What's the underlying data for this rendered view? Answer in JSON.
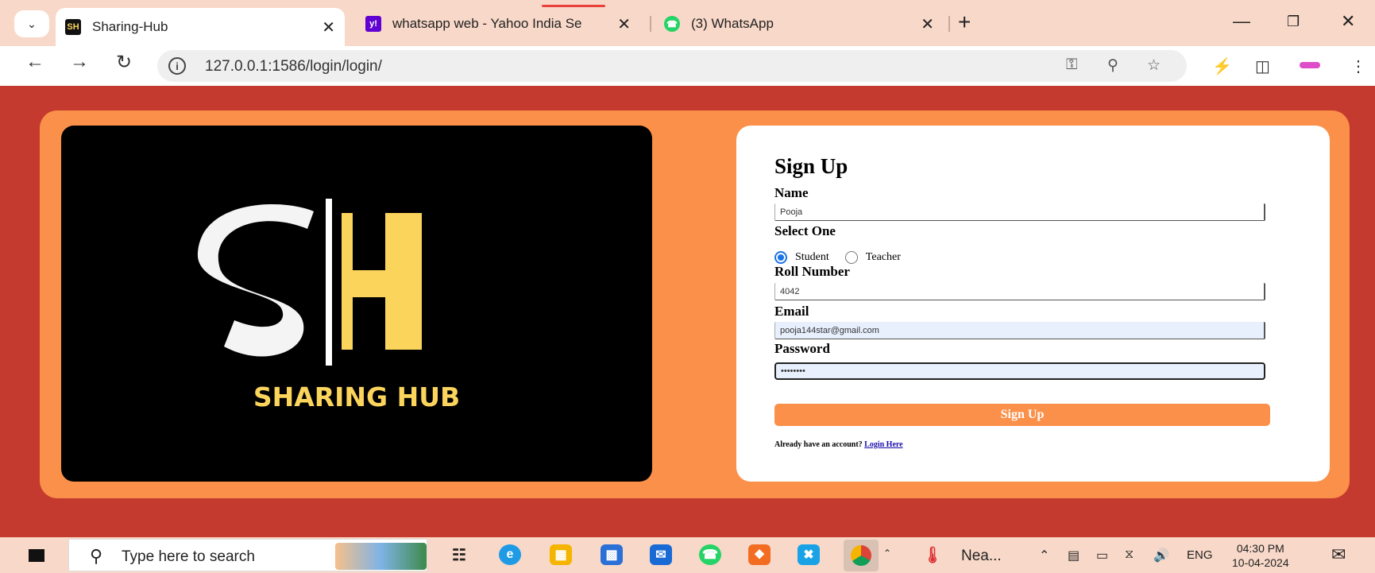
{
  "browser": {
    "tabs": [
      {
        "title": "Sharing-Hub",
        "active": true
      },
      {
        "title": "whatsapp web - Yahoo India Se",
        "active": false
      },
      {
        "title": "(3) WhatsApp",
        "active": false
      }
    ],
    "url": "127.0.0.1:1586/login/login/"
  },
  "logo": {
    "text": "SHARING HUB",
    "colors": {
      "accent": "#fbd45c",
      "background": "#000000"
    }
  },
  "form": {
    "title": "Sign Up",
    "name_label": "Name",
    "name_value": "Pooja",
    "select_label": "Select One",
    "option_student": "Student",
    "option_teacher": "Teacher",
    "selected_option": "Student",
    "roll_label": "Roll Number",
    "roll_value": "4042",
    "email_label": "Email",
    "email_value": "pooja144star@gmail.com",
    "password_label": "Password",
    "password_value": "••••••••",
    "submit_label": "Sign Up",
    "already_text": "Already have an account?",
    "login_link": "Login Here"
  },
  "taskbar": {
    "search_placeholder": "Type here to search",
    "weather": "Nea...",
    "language": "ENG",
    "time": "04:30 PM",
    "date": "10-04-2024"
  },
  "colors": {
    "page_bg": "#c53a2e",
    "card_bg": "#fb904a",
    "chrome_bg": "#f8d8c8"
  }
}
